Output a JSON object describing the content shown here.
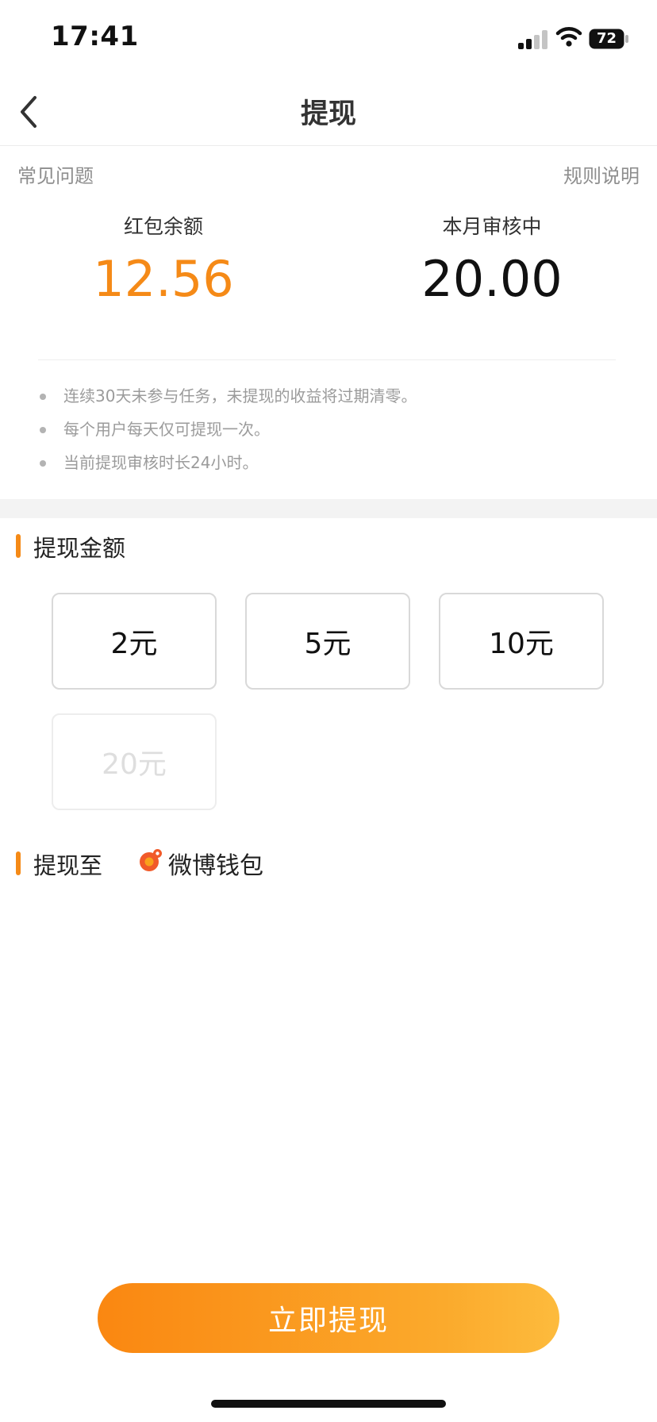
{
  "status_bar": {
    "time": "17:41",
    "battery": "72"
  },
  "nav": {
    "title": "提现"
  },
  "links": {
    "faq": "常见问题",
    "rules": "规则说明"
  },
  "balance": {
    "label": "红包余额",
    "value": "12.56",
    "review_label": "本月审核中",
    "review_value": "20.00"
  },
  "tips": [
    "连续30天未参与任务，未提现的收益将过期清零。",
    "每个用户每天仅可提现一次。",
    "当前提现审核时长24小时。"
  ],
  "amount_section": {
    "title": "提现金额",
    "options": [
      {
        "label": "2元",
        "enabled": true
      },
      {
        "label": "5元",
        "enabled": true
      },
      {
        "label": "10元",
        "enabled": true
      },
      {
        "label": "20元",
        "enabled": false
      }
    ]
  },
  "destination": {
    "title": "提现至",
    "wallet": "微博钱包",
    "icon": "weibo-wallet-icon"
  },
  "submit_label": "立即提现",
  "colors": {
    "accent": "#f58a17",
    "gradient_start": "#fa8711",
    "gradient_end": "#fdbb3d"
  }
}
